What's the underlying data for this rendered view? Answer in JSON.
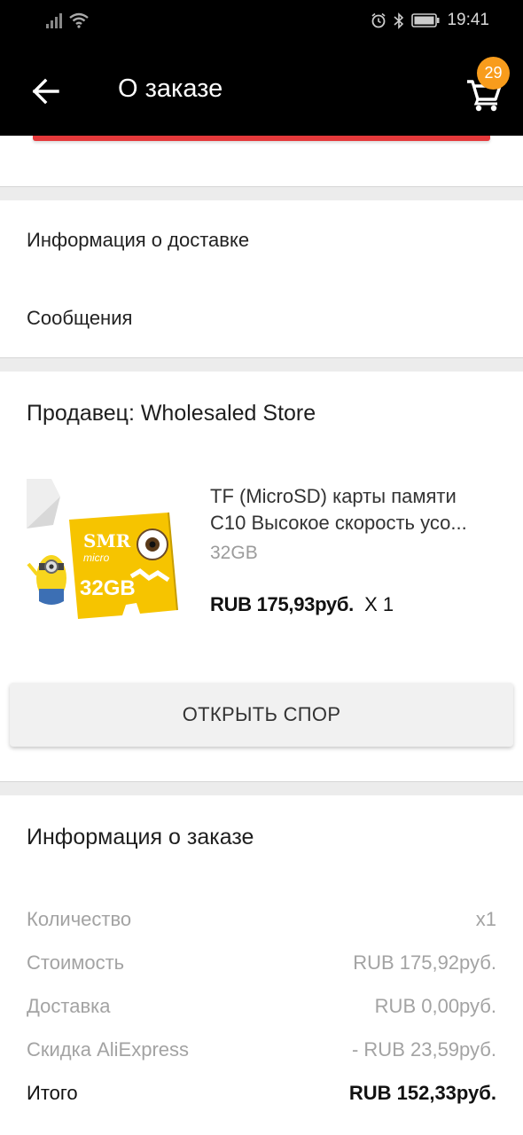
{
  "status_bar": {
    "time": "19:41",
    "icons": [
      "signal-icon",
      "wifi-icon",
      "alarm-icon",
      "bluetooth-icon",
      "battery-icon"
    ]
  },
  "header": {
    "title": "О заказе",
    "cart_count": "29",
    "back_icon": "arrow-left-icon",
    "cart_icon": "cart-icon"
  },
  "links": {
    "delivery_info": "Информация о доставке",
    "messages": "Сообщения"
  },
  "seller": {
    "label": "Продавец: Wholesaled Store"
  },
  "product": {
    "name_line1": "TF (MicroSD) карты памяти",
    "name_line2": "C10 Высокое скорость усо...",
    "variant": "32GB",
    "price": "RUB 175,93руб.",
    "quantity": "X 1",
    "image_text": {
      "brand": "SMR",
      "type": "micro",
      "capacity": "32GB"
    }
  },
  "dispute_button": "ОТКРЫТЬ СПОР",
  "order_info": {
    "title": "Информация о заказе",
    "rows": [
      {
        "label": "Количество",
        "value": "x1"
      },
      {
        "label": "Стоимость",
        "value": "RUB 175,92руб."
      },
      {
        "label": "Доставка",
        "value": "RUB 0,00руб."
      },
      {
        "label": "Скидка AliExpress",
        "value": "- RUB 23,59руб."
      }
    ],
    "total": {
      "label": "Итого",
      "value": "RUB 152,33руб."
    }
  },
  "colors": {
    "header_bg": "#000000",
    "badge": "#f89c1c",
    "accent_red": "#e5393b",
    "card_yellow": "#f6c400"
  }
}
